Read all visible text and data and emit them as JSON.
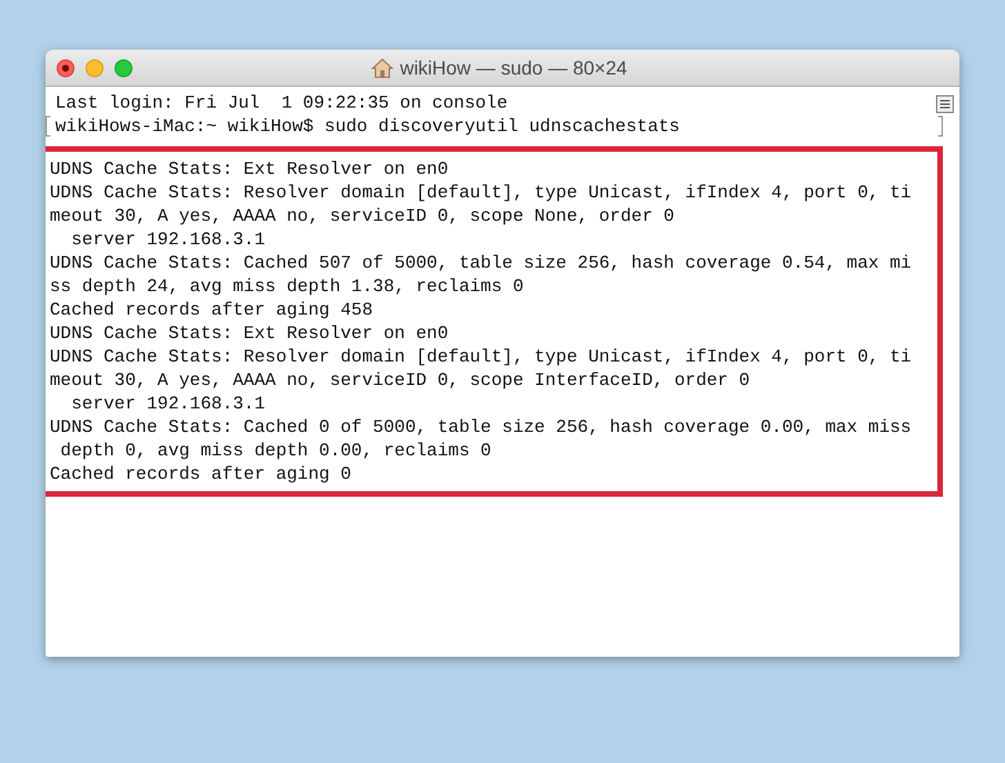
{
  "window": {
    "title": "wikiHow — sudo — 80×24"
  },
  "terminal": {
    "lines": [
      "Last login: Fri Jul  1 09:22:35 on console",
      "wikiHows-iMac:~ wikiHow$ sudo discoveryutil udnscachestats"
    ],
    "highlighted_output": [
      "UDNS Cache Stats: Ext Resolver on en0",
      "UDNS Cache Stats: Resolver domain [default], type Unicast, ifIndex 4, port 0, ti",
      "meout 30, A yes, AAAA no, serviceID 0, scope None, order 0",
      "  server 192.168.3.1",
      "UDNS Cache Stats: Cached 507 of 5000, table size 256, hash coverage 0.54, max mi",
      "ss depth 24, avg miss depth 1.38, reclaims 0",
      "Cached records after aging 458",
      "UDNS Cache Stats: Ext Resolver on en0",
      "UDNS Cache Stats: Resolver domain [default], type Unicast, ifIndex 4, port 0, ti",
      "meout 30, A yes, AAAA no, serviceID 0, scope InterfaceID, order 0",
      "  server 192.168.3.1",
      "UDNS Cache Stats: Cached 0 of 5000, table size 256, hash coverage 0.00, max miss",
      " depth 0, avg miss depth 0.00, reclaims 0",
      "Cached records after aging 0"
    ]
  }
}
